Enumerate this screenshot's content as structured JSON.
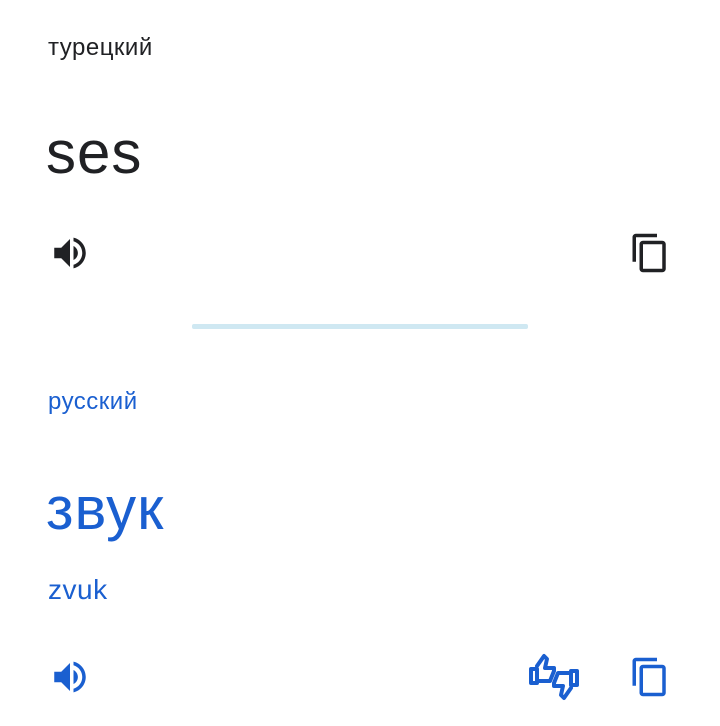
{
  "source": {
    "language": "турецкий",
    "text": "ses"
  },
  "target": {
    "language": "русский",
    "text": "звук",
    "transliteration": "zvuk"
  },
  "icons": {
    "source_speaker": "speaker-icon",
    "source_copy": "copy-icon",
    "target_speaker": "speaker-icon",
    "target_feedback": "feedback-thumbs-icon",
    "target_copy": "copy-icon"
  },
  "colors": {
    "source_text": "#202124",
    "target_text": "#1a5fd0",
    "divider": "#cfe8f2"
  }
}
